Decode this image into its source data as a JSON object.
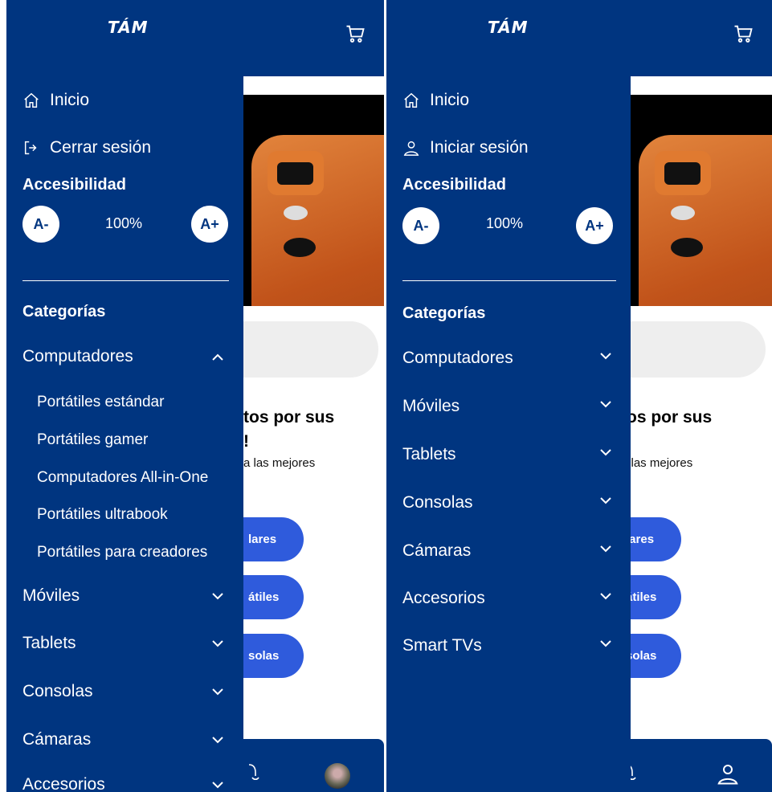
{
  "brand": {
    "logo_text": "TÁM",
    "primary": "#003580",
    "accent": "#2f5bdc"
  },
  "background_page": {
    "promo_title_line1": "tos por sus",
    "promo_title_line2": "!",
    "promo_sub": "a las mejores",
    "buttons": [
      "lares",
      "átiles",
      "solas"
    ]
  },
  "left": {
    "nav": {
      "home": "Inicio",
      "logout": "Cerrar sesión"
    },
    "accessibility": {
      "title": "Accesibilidad",
      "decrease": "A-",
      "increase": "A+",
      "zoom": "100%"
    },
    "categories_title": "Categorías",
    "categories": [
      {
        "label": "Computadores",
        "expanded": true
      },
      {
        "label": "Móviles"
      },
      {
        "label": "Tablets"
      },
      {
        "label": "Consolas"
      },
      {
        "label": "Cámaras"
      },
      {
        "label": "Accesorios"
      }
    ],
    "subcategories": [
      "Portátiles estándar",
      "Portátiles gamer",
      "Computadores All-in-One",
      "Portátiles ultrabook",
      "Portátiles para creadores"
    ]
  },
  "right": {
    "nav": {
      "home": "Inicio",
      "login": "Iniciar sesión"
    },
    "accessibility": {
      "title": "Accesibilidad",
      "decrease": "A-",
      "increase": "A+",
      "zoom": "100%"
    },
    "categories_title": "Categorías",
    "categories": [
      {
        "label": "Computadores"
      },
      {
        "label": "Móviles"
      },
      {
        "label": "Tablets"
      },
      {
        "label": "Consolas"
      },
      {
        "label": "Cámaras"
      },
      {
        "label": "Accesorios"
      },
      {
        "label": "Smart TVs"
      }
    ]
  }
}
